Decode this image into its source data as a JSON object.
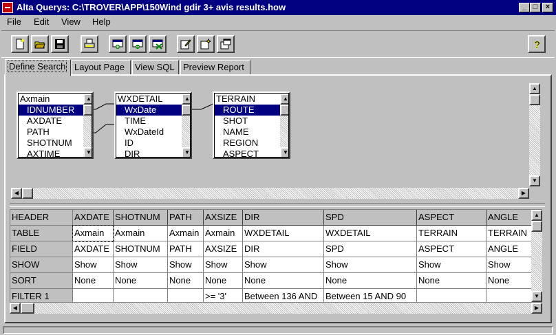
{
  "window": {
    "title": "Alta Querys: C:\\TROVER\\APP\\150Wind gdir 3+ avis results.how"
  },
  "menu": {
    "file": "File",
    "edit": "Edit",
    "view": "View",
    "help": "Help"
  },
  "tabs": [
    "Define Search",
    "Layout Page",
    "View SQL",
    "Preview Report"
  ],
  "tables": [
    {
      "title": "Axmain",
      "fields": [
        "IDNUMBER",
        "AXDATE",
        "PATH",
        "SHOTNUM",
        "AXTIME"
      ]
    },
    {
      "title": "WXDETAIL",
      "fields": [
        "WxDate",
        "TIME",
        "WxDateId",
        "ID",
        "DIR"
      ]
    },
    {
      "title": "TERRAIN",
      "fields": [
        "ROUTE",
        "SHOT",
        "NAME",
        "REGION",
        "ASPECT"
      ]
    }
  ],
  "grid": {
    "row_headers": [
      "HEADER",
      "TABLE",
      "FIELD",
      "SHOW",
      "SORT",
      "FILTER 1"
    ],
    "columns": [
      {
        "header": "AXDATE",
        "table": "Axmain",
        "field": "AXDATE",
        "show": "Show",
        "sort": "None",
        "filter": ""
      },
      {
        "header": "SHOTNUM",
        "table": "Axmain",
        "field": "SHOTNUM",
        "show": "Show",
        "sort": "None",
        "filter": ""
      },
      {
        "header": "PATH",
        "table": "Axmain",
        "field": "PATH",
        "show": "Show",
        "sort": "None",
        "filter": ""
      },
      {
        "header": "AXSIZE",
        "table": "Axmain",
        "field": "AXSIZE",
        "show": "Show",
        "sort": "None",
        "filter": ">= '3'"
      },
      {
        "header": "DIR",
        "table": "WXDETAIL",
        "field": "DIR",
        "show": "Show",
        "sort": "None",
        "filter": "Between 136 AND"
      },
      {
        "header": "SPD",
        "table": "WXDETAIL",
        "field": "SPD",
        "show": "Show",
        "sort": "None",
        "filter": "Between 15 AND 90"
      },
      {
        "header": "ASPECT",
        "table": "TERRAIN",
        "field": "ASPECT",
        "show": "Show",
        "sort": "None",
        "filter": ""
      },
      {
        "header": "ANGLE",
        "table": "TERRAIN",
        "field": "ANGLE",
        "show": "Show",
        "sort": "None",
        "filter": ""
      }
    ]
  },
  "colors": {
    "titlebar": "#000080",
    "face": "#c0c0c0",
    "selection": "#000080"
  }
}
